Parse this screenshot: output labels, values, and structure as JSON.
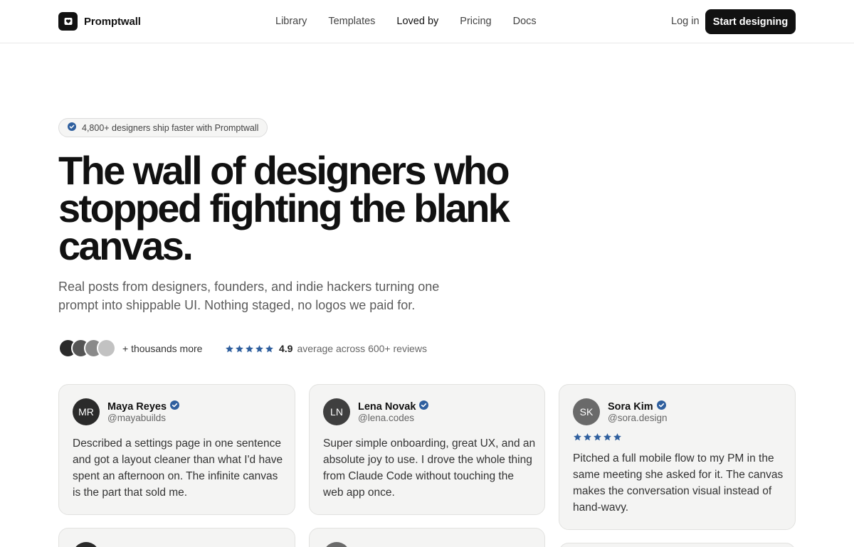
{
  "brand": {
    "name": "Promptwall"
  },
  "nav": [
    {
      "label": "Library"
    },
    {
      "label": "Templates"
    },
    {
      "label": "Loved by"
    },
    {
      "label": "Pricing"
    },
    {
      "label": "Docs"
    }
  ],
  "header": {
    "login_label": "Log in",
    "cta_label": "Start designing"
  },
  "hero": {
    "badge": "4,800+ designers ship faster with Promptwall",
    "title": "The wall of designers who stopped fighting the blank canvas.",
    "subtitle": "Real posts from designers, founders, and indie hackers turning one prompt into shippable UI. Nothing staged, no logos we paid for.",
    "more_label": "+ thousands more",
    "rating_score": "4.9",
    "rating_text": "average across 600+ reviews",
    "rating_stars": 5
  },
  "colors": {
    "accent": "#2f5f9e",
    "dark": "#111111",
    "card_bg": "#f4f4f3"
  },
  "icons": {
    "brand": "heart-icon",
    "verified": "verified-badge-icon",
    "star": "star-icon"
  },
  "testimonials": [
    {
      "initials": "MR",
      "name": "Maya Reyes",
      "handle": "@mayabuilds",
      "stars": 0,
      "text": "Described a settings page in one sentence and got a layout cleaner than what I'd have spent an afternoon on. The infinite canvas is the part that sold me."
    },
    {
      "initials": "LN",
      "name": "Lena Novak",
      "handle": "@lena.codes",
      "stars": 0,
      "text": "Super simple onboarding, great UX, and an absolute joy to use. I drove the whole thing from Claude Code without touching the web app once."
    },
    {
      "initials": "SK",
      "name": "Sora Kim",
      "handle": "@sora.design",
      "stars": 5,
      "text": "Pitched a full mobile flow to my PM in the same meeting she asked for it. The canvas makes the conversation visual instead of hand-wavy."
    }
  ]
}
